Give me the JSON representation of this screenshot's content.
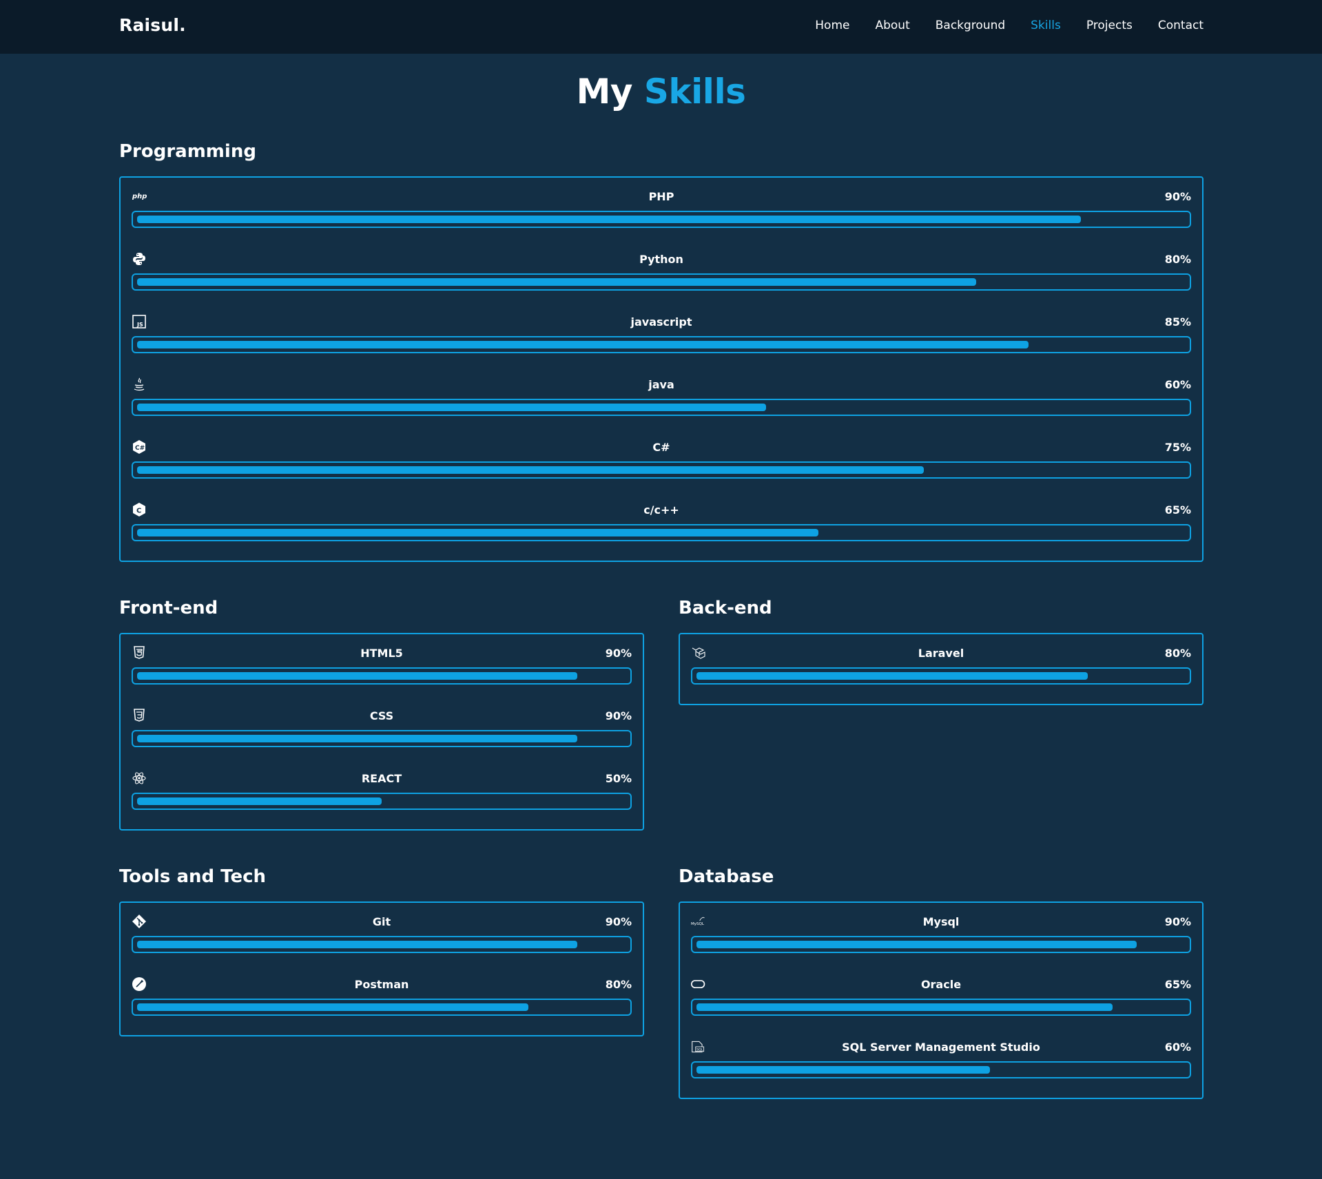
{
  "nav": {
    "logo": "Raisul.",
    "links": [
      "Home",
      "About",
      "Background",
      "Skills",
      "Projects",
      "Contact"
    ],
    "active": "Skills"
  },
  "title": {
    "word1": "My",
    "word2": "Skills"
  },
  "colors": {
    "accent": "#0ea2e3",
    "background": "#132f45",
    "navbar": "#0b1b29"
  },
  "sections": {
    "programming": {
      "title": "Programming",
      "skills": [
        {
          "name": "PHP",
          "percent": "90%",
          "fill": 0.9,
          "icon": "php-icon"
        },
        {
          "name": "Python",
          "percent": "80%",
          "fill": 0.8,
          "icon": "python-icon"
        },
        {
          "name": "javascript",
          "percent": "85%",
          "fill": 0.85,
          "icon": "javascript-icon"
        },
        {
          "name": "java",
          "percent": "60%",
          "fill": 0.6,
          "icon": "java-icon"
        },
        {
          "name": "C#",
          "percent": "75%",
          "fill": 0.75,
          "icon": "csharp-icon"
        },
        {
          "name": "c/c++",
          "percent": "65%",
          "fill": 0.65,
          "icon": "c-icon"
        }
      ]
    },
    "frontend": {
      "title": "Front-end",
      "skills": [
        {
          "name": "HTML5",
          "percent": "90%",
          "fill": 0.9,
          "icon": "html5-icon"
        },
        {
          "name": "CSS",
          "percent": "90%",
          "fill": 0.9,
          "icon": "css3-icon"
        },
        {
          "name": "REACT",
          "percent": "50%",
          "fill": 0.5,
          "icon": "react-icon"
        }
      ]
    },
    "backend": {
      "title": "Back-end",
      "skills": [
        {
          "name": "Laravel",
          "percent": "80%",
          "fill": 0.8,
          "icon": "laravel-icon"
        }
      ]
    },
    "tools": {
      "title": "Tools and Tech",
      "skills": [
        {
          "name": "Git",
          "percent": "90%",
          "fill": 0.9,
          "icon": "git-icon"
        },
        {
          "name": "Postman",
          "percent": "80%",
          "fill": 0.8,
          "icon": "postman-icon"
        }
      ]
    },
    "database": {
      "title": "Database",
      "skills": [
        {
          "name": "Mysql",
          "percent": "90%",
          "fill": 0.9,
          "icon": "mysql-icon",
          "icon_text": "MySQL"
        },
        {
          "name": "Oracle",
          "percent": "65%",
          "fill": 0.85,
          "icon": "oracle-icon"
        },
        {
          "name": "SQL Server Management Studio",
          "percent": "60%",
          "fill": 0.6,
          "icon": "sql-server-icon",
          "icon_text": "SQL"
        }
      ]
    }
  }
}
